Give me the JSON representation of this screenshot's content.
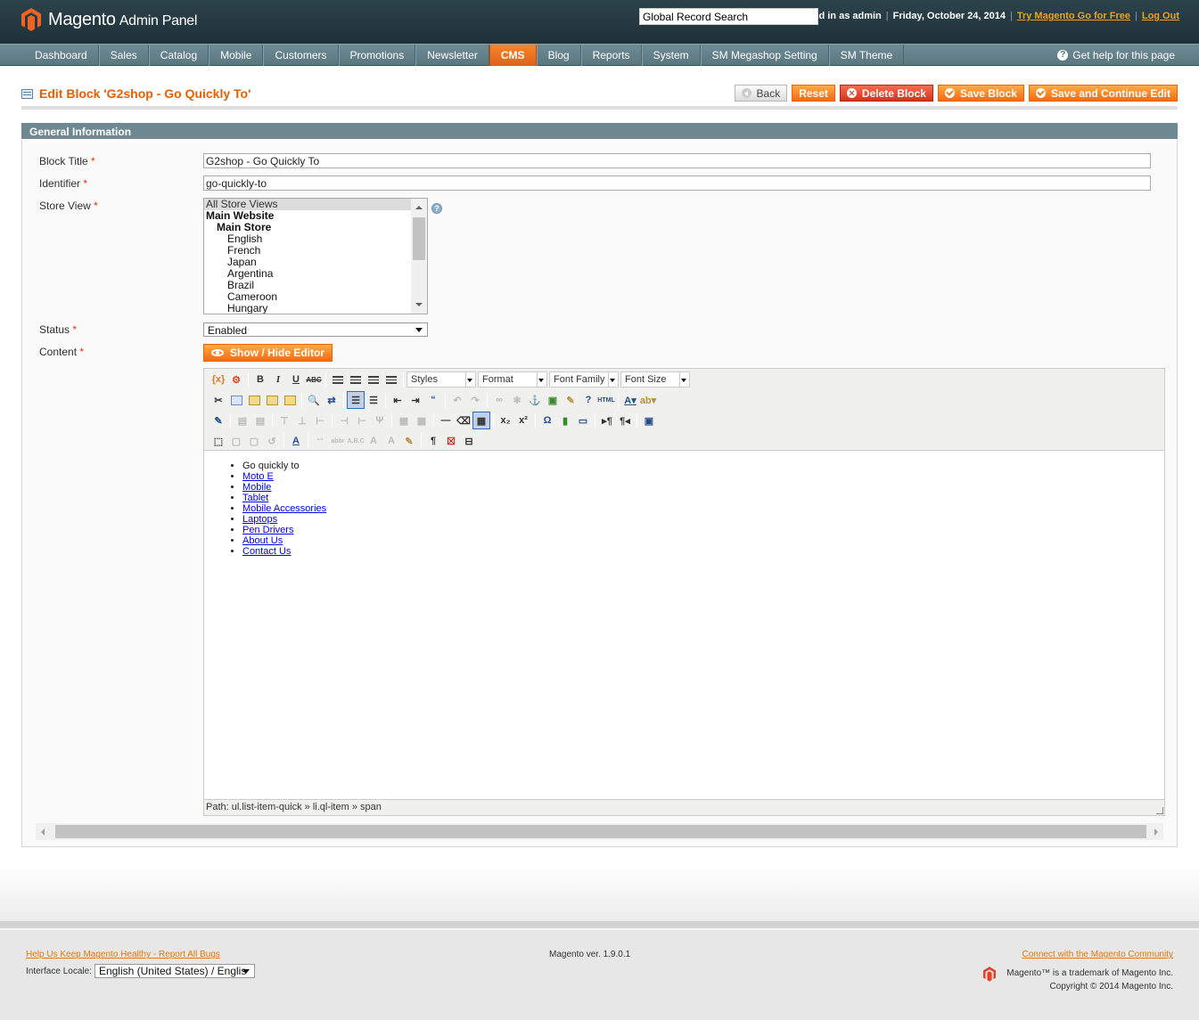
{
  "header": {
    "app_name": "Magento",
    "app_sub": "Admin Panel",
    "search_value": "Global Record Search",
    "logged_in": "Logged in as admin",
    "date": "Friday, October 24, 2014",
    "try_link": "Try Magento Go for Free",
    "logout_link": "Log Out"
  },
  "nav": {
    "items": [
      {
        "label": "Dashboard"
      },
      {
        "label": "Sales"
      },
      {
        "label": "Catalog"
      },
      {
        "label": "Mobile"
      },
      {
        "label": "Customers"
      },
      {
        "label": "Promotions"
      },
      {
        "label": "Newsletter"
      },
      {
        "label": "CMS",
        "active": true
      },
      {
        "label": "Blog"
      },
      {
        "label": "Reports"
      },
      {
        "label": "System"
      },
      {
        "label": "SM Megashop Setting"
      },
      {
        "label": "SM Theme"
      }
    ],
    "help": "Get help for this page"
  },
  "page": {
    "title": "Edit Block 'G2shop - Go Quickly To'",
    "buttons": {
      "back": "Back",
      "reset": "Reset",
      "delete": "Delete Block",
      "save": "Save Block",
      "save_continue": "Save and Continue Edit"
    }
  },
  "form": {
    "section_title": "General Information",
    "block_title_label": "Block Title",
    "block_title_value": "G2shop - Go Quickly To",
    "identifier_label": "Identifier",
    "identifier_value": "go-quickly-to",
    "store_view_label": "Store View",
    "store_views": [
      {
        "label": "All Store Views",
        "level": 0,
        "selected": true
      },
      {
        "label": "Main Website",
        "level": 0,
        "bold": true
      },
      {
        "label": "Main Store",
        "level": 1,
        "bold": true
      },
      {
        "label": "English",
        "level": 2
      },
      {
        "label": "French",
        "level": 2
      },
      {
        "label": "Japan",
        "level": 2
      },
      {
        "label": "Argentina",
        "level": 2
      },
      {
        "label": "Brazil",
        "level": 2
      },
      {
        "label": "Cameroon",
        "level": 2
      },
      {
        "label": "Hungary",
        "level": 2
      }
    ],
    "status_label": "Status",
    "status_value": "Enabled",
    "content_label": "Content",
    "toggle_editor": "Show / Hide Editor",
    "required_mark": "*"
  },
  "editor": {
    "selects": [
      "Styles",
      "Format",
      "Font Family",
      "Font Size"
    ],
    "content_items": [
      {
        "text": "Go quickly to",
        "link": false
      },
      {
        "text": "Moto E",
        "link": true
      },
      {
        "text": "Mobile",
        "link": true
      },
      {
        "text": "Tablet",
        "link": true
      },
      {
        "text": "Mobile Accessories",
        "link": true
      },
      {
        "text": "Laptops",
        "link": true
      },
      {
        "text": "Pen Drivers",
        "link": true
      },
      {
        "text": "About Us",
        "link": true
      },
      {
        "text": "Contact Us",
        "link": true
      }
    ],
    "path": "Path: ul.list-item-quick » li.ql-item » span"
  },
  "footer": {
    "report_link": "Help Us Keep Magento Healthy - Report All Bugs",
    "locale_label": "Interface Locale:",
    "locale_value": "English (United States) / Englis",
    "version": "Magento ver. 1.9.0.1",
    "community_link": "Connect with the Magento Community",
    "trademark": "Magento™ is a trademark of Magento Inc.",
    "copyright": "Copyright © 2014 Magento Inc."
  },
  "colors": {
    "accent": "#eb5e00",
    "header_bg": "#253a42",
    "nav_bg": "#6f8b95",
    "link": "#0000ee"
  }
}
